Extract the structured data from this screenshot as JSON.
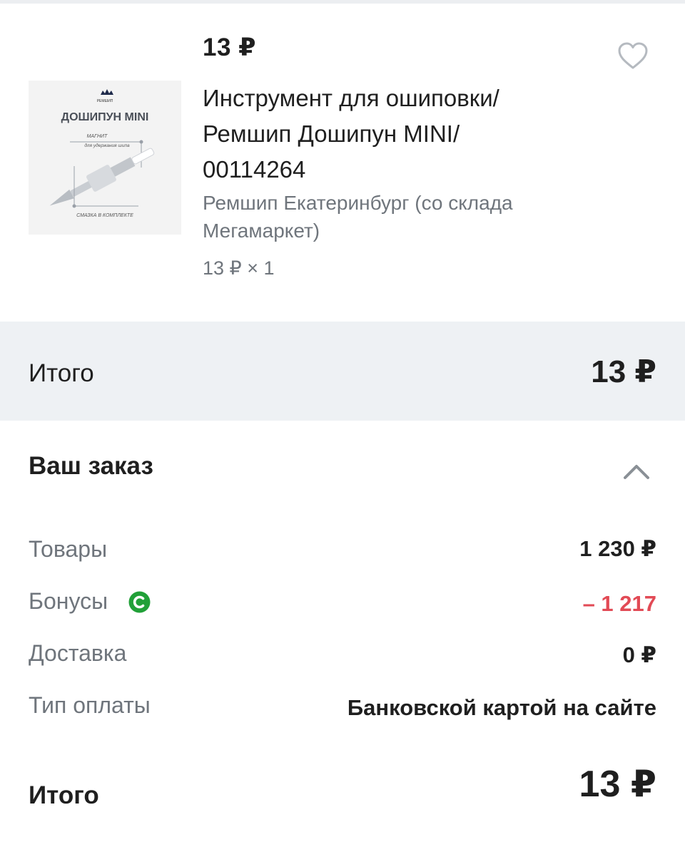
{
  "product": {
    "price": "13 ₽",
    "title": "Инструмент для ошиповки/\nРемшип  Дошипун MINI/\n00114264",
    "seller": "Ремшип Екатеринбург (со склада Мегамаркет)",
    "quantity_line": "13 ₽ × 1",
    "image": {
      "brand": "РЕМШИП",
      "name": "ДОШИПУН MINI",
      "callout_top": "МАГНИТ",
      "callout_top_sub": "для удержания шипа",
      "callout_bottom": "СМАЗКА В КОМПЛЕКТЕ"
    },
    "favorite_icon": "heart-outline-icon"
  },
  "total_band": {
    "label": "Итого",
    "value": "13 ₽"
  },
  "order": {
    "title": "Ваш заказ",
    "toggle_icon": "chevron-up-icon",
    "rows": [
      {
        "label": "Товары",
        "value": "1 230 ₽"
      },
      {
        "label": "Бонусы",
        "value": "– 1 217"
      },
      {
        "label": "Доставка",
        "value": "0 ₽"
      },
      {
        "label": "Тип оплаты",
        "value": "Банковской картой на сайте"
      }
    ],
    "bonus_icon": "bonus-coin-icon",
    "bonus_icon_color": "#21a038",
    "negative_color": "#e24a55"
  },
  "final": {
    "label": "Итого",
    "value": "13 ₽"
  }
}
